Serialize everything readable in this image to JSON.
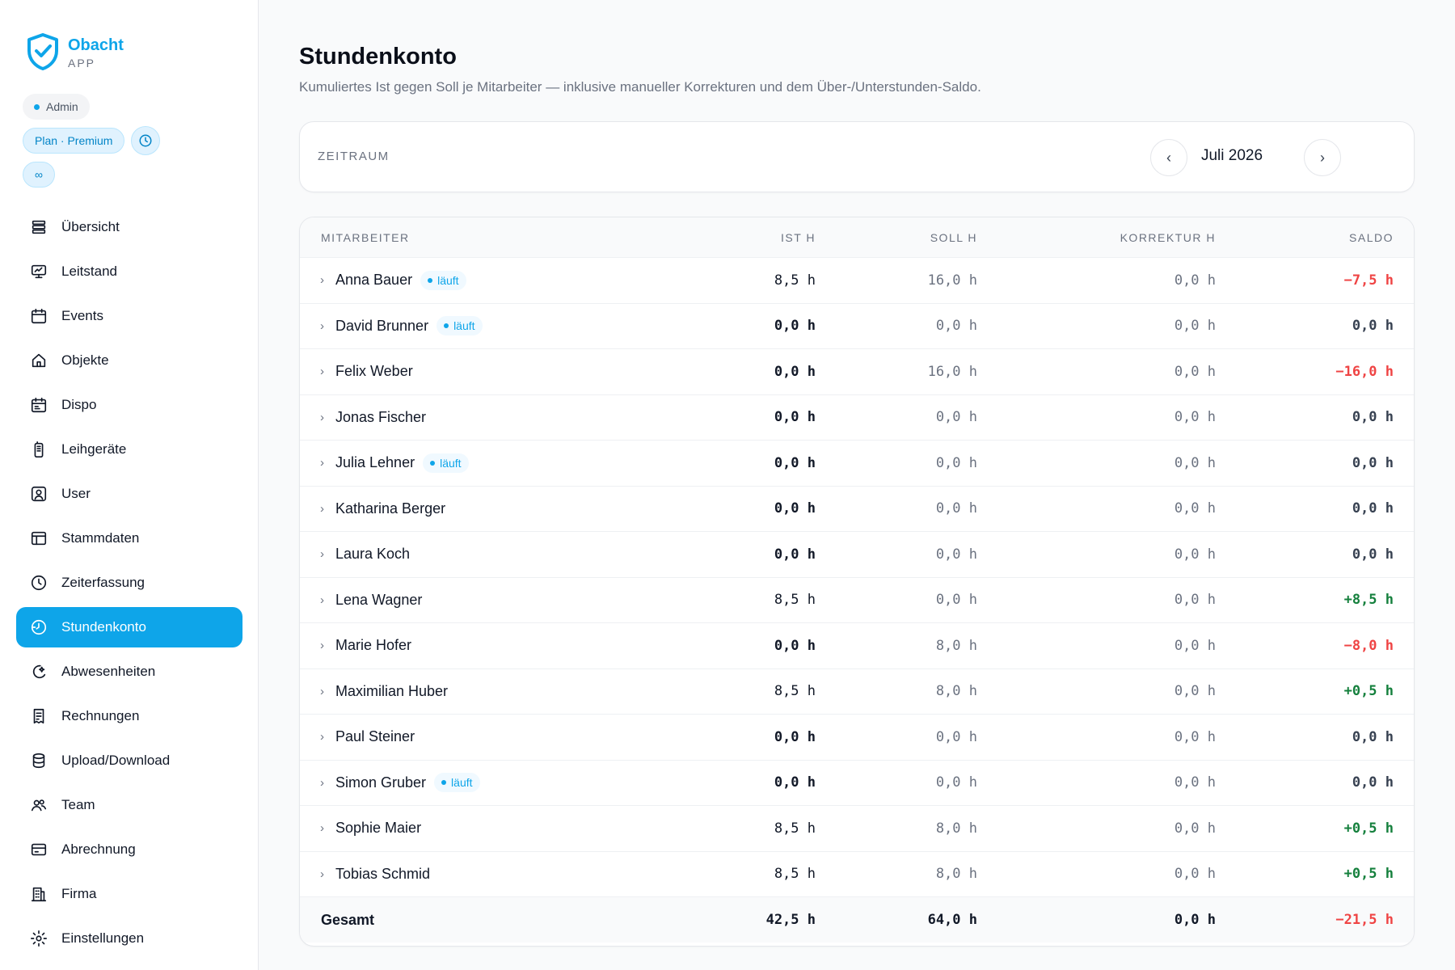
{
  "brand": {
    "name": "Obacht",
    "sub": "APP"
  },
  "badges": {
    "role": "Admin",
    "plan": "Plan · Premium",
    "unlimited": "∞"
  },
  "nav": [
    {
      "label": "Übersicht",
      "icon": "stack-icon",
      "active": false
    },
    {
      "label": "Leitstand",
      "icon": "monitor-icon",
      "active": false
    },
    {
      "label": "Events",
      "icon": "calendar-icon",
      "active": false
    },
    {
      "label": "Objekte",
      "icon": "home-icon",
      "active": false
    },
    {
      "label": "Dispo",
      "icon": "calendar-list-icon",
      "active": false
    },
    {
      "label": "Leihgeräte",
      "icon": "radio-device-icon",
      "active": false
    },
    {
      "label": "User",
      "icon": "user-square-icon",
      "active": false
    },
    {
      "label": "Stammdaten",
      "icon": "layout-icon",
      "active": false
    },
    {
      "label": "Zeiterfassung",
      "icon": "clock-icon",
      "active": false
    },
    {
      "label": "Stundenkonto",
      "icon": "clock-history-icon",
      "active": true
    },
    {
      "label": "Abwesenheiten",
      "icon": "moon-sun-icon",
      "active": false
    },
    {
      "label": "Rechnungen",
      "icon": "receipt-icon",
      "active": false
    },
    {
      "label": "Upload/Download",
      "icon": "database-icon",
      "active": false
    },
    {
      "label": "Team",
      "icon": "users-icon",
      "active": false
    },
    {
      "label": "Abrechnung",
      "icon": "credit-card-icon",
      "active": false
    },
    {
      "label": "Firma",
      "icon": "building-icon",
      "active": false
    },
    {
      "label": "Einstellungen",
      "icon": "gear-icon",
      "active": false
    }
  ],
  "page": {
    "title": "Stundenkonto",
    "subtitle": "Kumuliertes Ist gegen Soll je Mitarbeiter — inklusive manueller Korrekturen und dem Über-/Unterstunden-Saldo."
  },
  "period": {
    "label": "ZEITRAUM",
    "value": "Juli 2026",
    "prev": "‹",
    "next": "›"
  },
  "table": {
    "headers": {
      "name": "MITARBEITER",
      "ist": "IST H",
      "soll": "SOLL H",
      "korr": "KORREKTUR H",
      "saldo": "SALDO"
    },
    "running_label": "läuft",
    "rows": [
      {
        "name": "Anna Bauer",
        "running": true,
        "ist": "8,5 h",
        "soll": "16,0 h",
        "korr": "0,0 h",
        "saldo": "−7,5 h",
        "sign": "neg"
      },
      {
        "name": "David Brunner",
        "running": true,
        "ist": "0,0 h",
        "soll": "0,0 h",
        "korr": "0,0 h",
        "saldo": "0,0 h",
        "sign": "zero"
      },
      {
        "name": "Felix Weber",
        "running": false,
        "ist": "0,0 h",
        "soll": "16,0 h",
        "korr": "0,0 h",
        "saldo": "−16,0 h",
        "sign": "neg"
      },
      {
        "name": "Jonas Fischer",
        "running": false,
        "ist": "0,0 h",
        "soll": "0,0 h",
        "korr": "0,0 h",
        "saldo": "0,0 h",
        "sign": "zero"
      },
      {
        "name": "Julia Lehner",
        "running": true,
        "ist": "0,0 h",
        "soll": "0,0 h",
        "korr": "0,0 h",
        "saldo": "0,0 h",
        "sign": "zero"
      },
      {
        "name": "Katharina Berger",
        "running": false,
        "ist": "0,0 h",
        "soll": "0,0 h",
        "korr": "0,0 h",
        "saldo": "0,0 h",
        "sign": "zero"
      },
      {
        "name": "Laura Koch",
        "running": false,
        "ist": "0,0 h",
        "soll": "0,0 h",
        "korr": "0,0 h",
        "saldo": "0,0 h",
        "sign": "zero"
      },
      {
        "name": "Lena Wagner",
        "running": false,
        "ist": "8,5 h",
        "soll": "0,0 h",
        "korr": "0,0 h",
        "saldo": "+8,5 h",
        "sign": "pos"
      },
      {
        "name": "Marie Hofer",
        "running": false,
        "ist": "0,0 h",
        "soll": "8,0 h",
        "korr": "0,0 h",
        "saldo": "−8,0 h",
        "sign": "neg"
      },
      {
        "name": "Maximilian Huber",
        "running": false,
        "ist": "8,5 h",
        "soll": "8,0 h",
        "korr": "0,0 h",
        "saldo": "+0,5 h",
        "sign": "pos"
      },
      {
        "name": "Paul Steiner",
        "running": false,
        "ist": "0,0 h",
        "soll": "0,0 h",
        "korr": "0,0 h",
        "saldo": "0,0 h",
        "sign": "zero"
      },
      {
        "name": "Simon Gruber",
        "running": true,
        "ist": "0,0 h",
        "soll": "0,0 h",
        "korr": "0,0 h",
        "saldo": "0,0 h",
        "sign": "zero"
      },
      {
        "name": "Sophie Maier",
        "running": false,
        "ist": "8,5 h",
        "soll": "8,0 h",
        "korr": "0,0 h",
        "saldo": "+0,5 h",
        "sign": "pos"
      },
      {
        "name": "Tobias Schmid",
        "running": false,
        "ist": "8,5 h",
        "soll": "8,0 h",
        "korr": "0,0 h",
        "saldo": "+0,5 h",
        "sign": "pos"
      }
    ],
    "total": {
      "label": "Gesamt",
      "ist": "42,5 h",
      "soll": "64,0 h",
      "korr": "0,0 h",
      "saldo": "−21,5 h",
      "sign": "neg"
    }
  },
  "colors": {
    "accent": "#0ea5e9",
    "negative": "#ef4444",
    "positive": "#15803d"
  }
}
